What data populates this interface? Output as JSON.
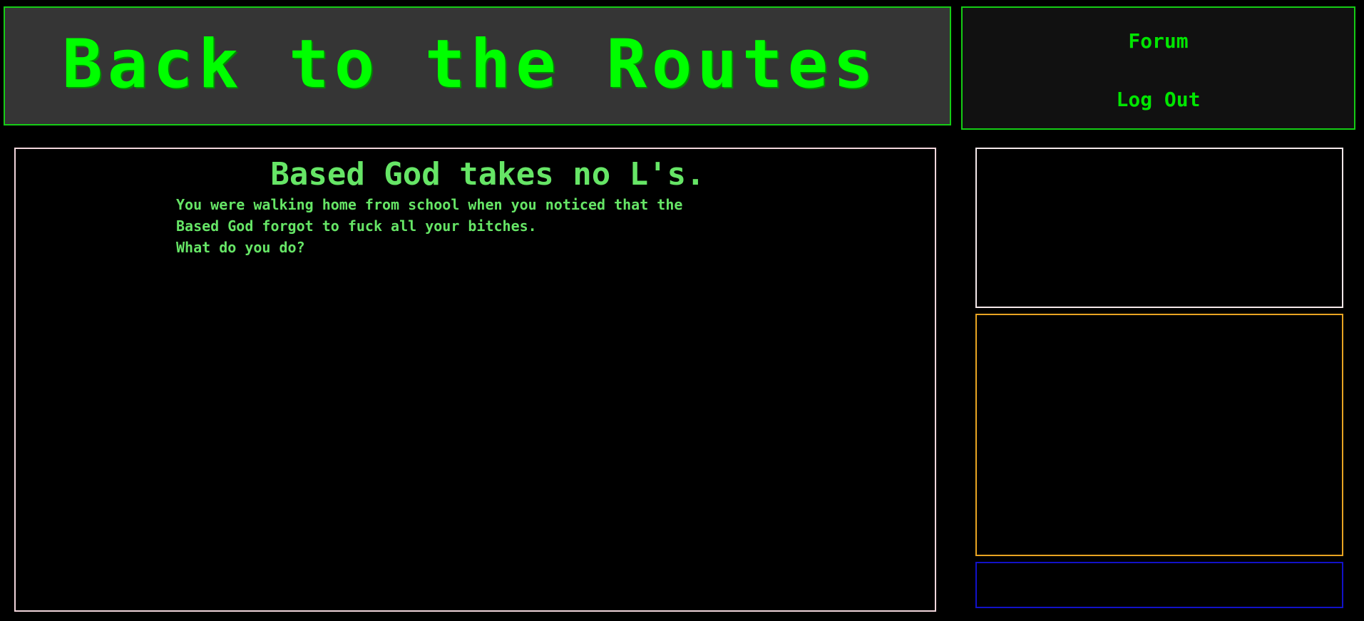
{
  "header": {
    "title": "Back to the Routes"
  },
  "nav": {
    "forum_label": "Forum",
    "logout_label": "Log Out"
  },
  "story": {
    "title": "Based God takes no L's.",
    "lines": [
      "You were walking home from school when you noticed that the",
      "Based God forgot to fuck all your bitches.",
      "What do you do?"
    ]
  },
  "colors": {
    "background": "#000000",
    "accent_green": "#00ff00",
    "text_green": "#66e566",
    "banner_bg": "#353535",
    "story_border": "#f2d6dc",
    "panel_top_border": "#f4e8ea",
    "panel_middle_border": "#e8a422",
    "panel_bottom_border": "#1212c8"
  }
}
